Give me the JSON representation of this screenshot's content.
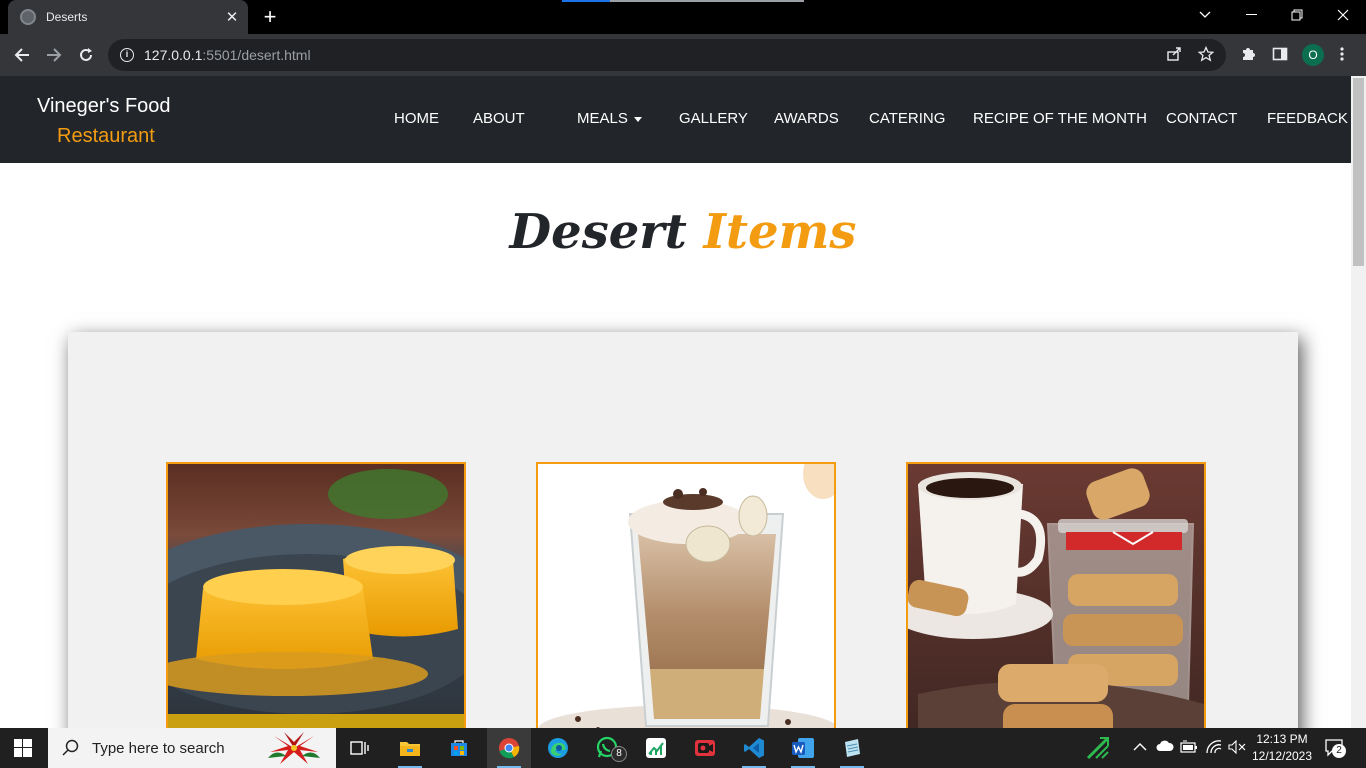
{
  "browser": {
    "tab_title": "Deserts",
    "tab_close": "✕",
    "new_tab": "+",
    "url_host": "127.0.0.1",
    "url_rest": ":5501/desert.html",
    "profile_initial": "O"
  },
  "site": {
    "logo_line1": "Vineger's Food",
    "logo_line2": "Restaurant",
    "nav": {
      "home": "HOME",
      "about": "ABOUT",
      "meals": "MEALS",
      "gallery": "GALLERY",
      "awards": "AWARDS",
      "catering": "CATERING",
      "recipe": "RECIPE OF THE MONTH",
      "contact": "CONTACT",
      "feedback": "FEEDBACK"
    },
    "heading_word1": "Desert",
    "heading_word2": "Items",
    "accent_color": "#f39c12",
    "header_bg": "#22252a",
    "cards": [
      {
        "image": "custard pudding"
      },
      {
        "image": "chocolate banana parfait"
      },
      {
        "image": "biscotti with coffee"
      }
    ]
  },
  "taskbar": {
    "search_placeholder": "Type here to search",
    "whatsapp_badge": "8",
    "time": "12:13 PM",
    "date": "12/12/2023",
    "notification_count": "2"
  }
}
